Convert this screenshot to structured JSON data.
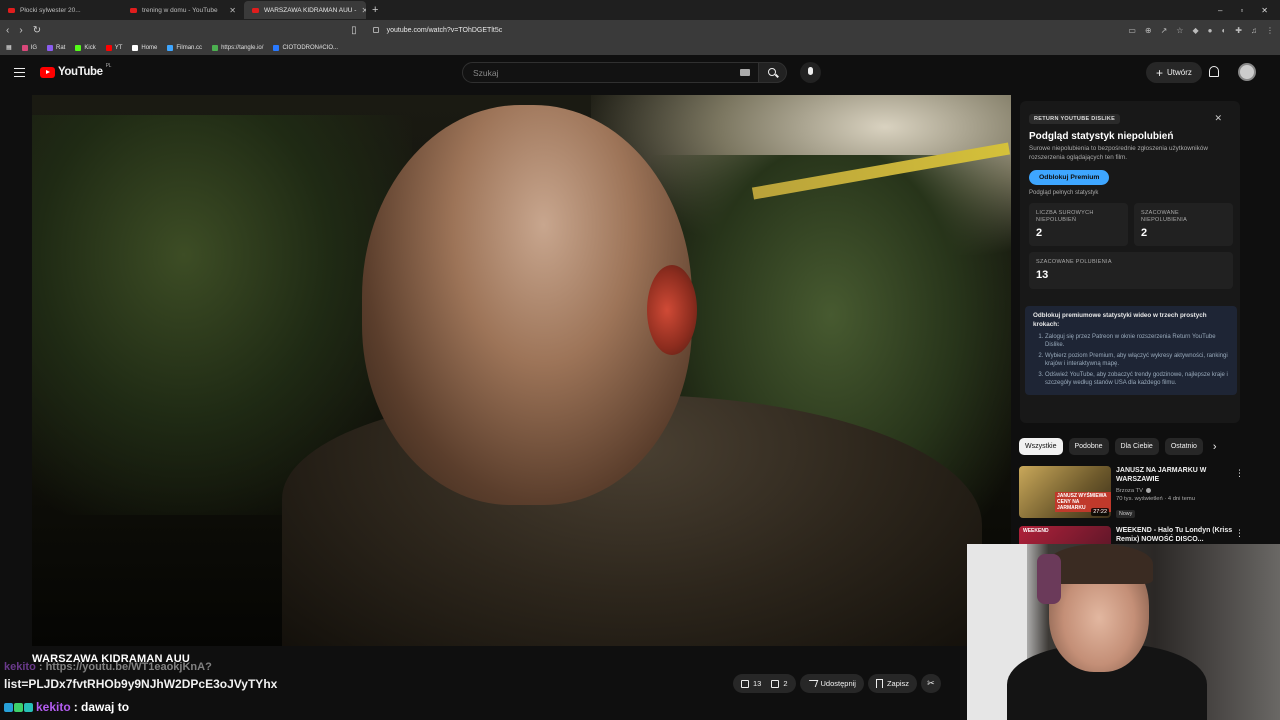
{
  "browser": {
    "tabs": [
      {
        "title": "Płocki sylwester 20..."
      },
      {
        "title": "trening w domu - YouTube"
      },
      {
        "title": "WARSZAWA KIDRAMAN AUU -"
      }
    ],
    "url": "youtube.com/watch?v=TOhDGETlt5c",
    "bookmarks": [
      "IG",
      "Rat",
      "Kick",
      "YT",
      "Home",
      "Filman.cc",
      "https://tangle.io/",
      "CIOTODRON#CIO..."
    ]
  },
  "youtube": {
    "logo_text": "YouTube",
    "logo_region": "PL",
    "search_placeholder": "Szukaj",
    "create_label": "Utwórz"
  },
  "video": {
    "title": "WARSZAWA KIDRAMAN AUU",
    "likes": "13",
    "dislikes": "2",
    "share_label": "Udostępnij",
    "save_label": "Zapisz"
  },
  "chat": {
    "line1_user": "kekito",
    "line1_text": ": https://youtu.be/WT1eaokjKnA?",
    "line2_text": "list=PLJDx7fvtRHOb9y9NJhW2DPcE3oJVyTYhx",
    "line3_user": "kekito",
    "line3_text": ": dawaj to"
  },
  "ryd": {
    "badge": "RETURN YOUTUBE DISLIKE",
    "title": "Podgląd statystyk niepolubień",
    "description": "Surowe niepolubienia to bezpośrednie zgłoszenia użytkowników rozszerzenia oglądających ten film.",
    "unlock_button": "Odblokuj Premium",
    "full_stats_note": "Podgląd pełnych statystyk",
    "stats": [
      {
        "label": "LICZBA SUROWYCH NIEPOLUBIEŃ",
        "value": "2"
      },
      {
        "label": "SZACOWANE NIEPOLUBIENIA",
        "value": "2"
      },
      {
        "label": "SZACOWANE POLUBIENIA",
        "value": "13"
      }
    ],
    "steps_title": "Odblokuj premiumowe statystyki wideo w trzech prostych krokach:",
    "steps": [
      "Zaloguj się przez Patreon w oknie rozszerzenia Return YouTube Dislike.",
      "Wybierz poziom Premium, aby włączyć wykresy aktywności, rankingi krajów i interaktywną mapę.",
      "Odśwież YouTube, aby zobaczyć trendy godzinowe, najlepsze kraje i szczegóły według stanów USA dla każdego filmu."
    ]
  },
  "chips": [
    "Wszystkie",
    "Podobne",
    "Dla Ciebie",
    "Ostatnio"
  ],
  "recommendations": [
    {
      "title": "JANUSZ NA JARMARKU W WARSZAWIE",
      "channel": "Brzoza TV",
      "meta": "70 tys. wyświetleń · 4 dni temu",
      "badge": "Nowy",
      "duration": "27:22",
      "thumb_text": "JANUSZ WYŚMIEWA CENY NA JARMARKU"
    },
    {
      "title": "WEEKEND - Halo Tu Londyn (Kriss Remix) NOWOŚĆ DISCO...",
      "channel": "",
      "meta": "",
      "badge": "",
      "duration": "",
      "thumb_text": "WEEKEND"
    }
  ],
  "colors": {
    "accent_blue": "#3ea6ff",
    "yt_red": "#ff0000",
    "chat_user": "#b35df0"
  }
}
